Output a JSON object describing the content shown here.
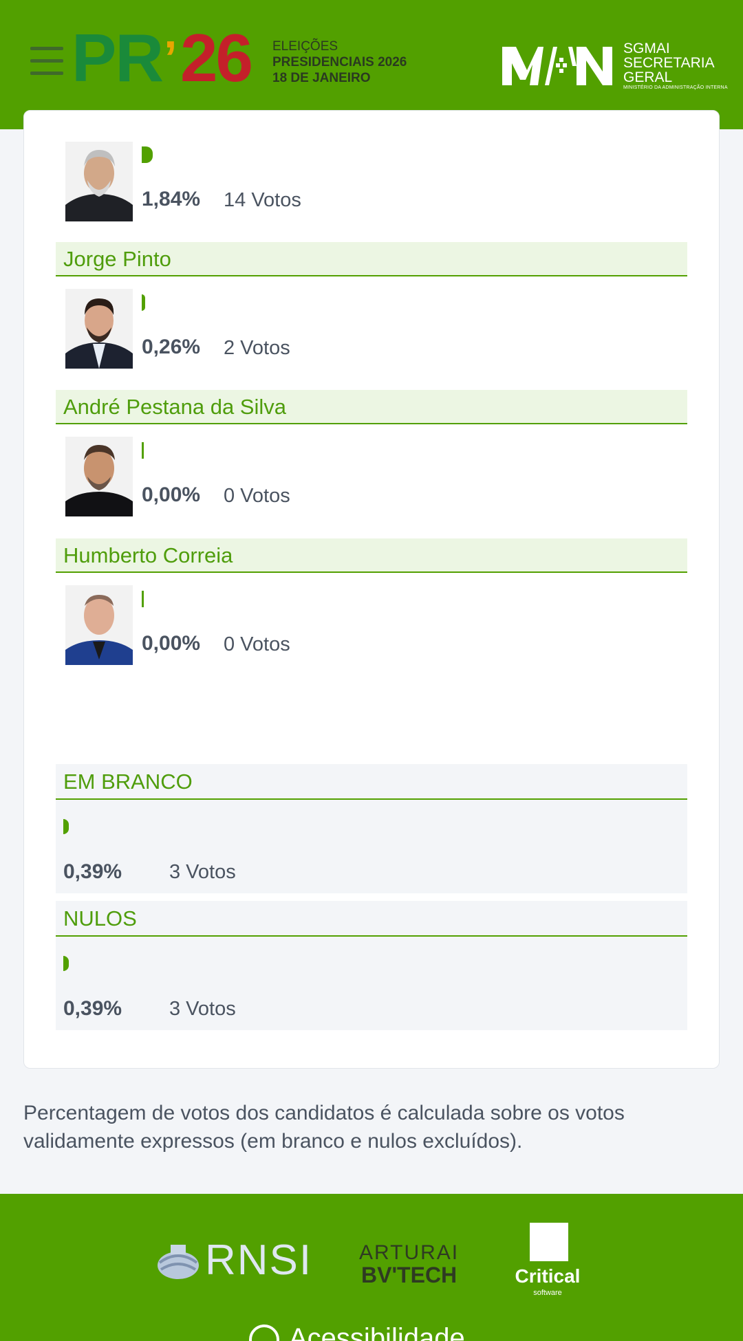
{
  "header": {
    "logo_pr": "PR",
    "logo_apostrophe": "’",
    "logo_26": "26",
    "logo_line1": "ELEIÇÕES",
    "logo_line2": "PRESIDENCIAIS 2026",
    "logo_line3": "18 DE JANEIRO",
    "org_line1": "SGMAI",
    "org_line2": "SECRETARIA",
    "org_line3": "GERAL",
    "org_line4": "MINISTÉRIO DA ADMINISTRAÇÃO INTERNA",
    "brand_color": "#52a000"
  },
  "candidates": [
    {
      "name": "",
      "percent": "1,84%",
      "votes": "14 Votos",
      "bar_fraction": 0.0184
    },
    {
      "name": "Jorge Pinto",
      "percent": "0,26%",
      "votes": "2 Votos",
      "bar_fraction": 0.0026
    },
    {
      "name": "André Pestana da Silva",
      "percent": "0,00%",
      "votes": "0 Votos",
      "bar_fraction": 0.0
    },
    {
      "name": "Humberto Correia",
      "percent": "0,00%",
      "votes": "0 Votos",
      "bar_fraction": 0.0
    }
  ],
  "blank": {
    "label": "EM BRANCO",
    "percent": "0,39%",
    "votes": "3 Votos"
  },
  "null_votes": {
    "label": "NULOS",
    "percent": "0,39%",
    "votes": "3 Votos"
  },
  "note": "Percentagem de votos dos candidatos é calculada sobre os votos validamente expressos (em branco e nulos excluídos).",
  "footer": {
    "partner1": "RNSI",
    "partner2_line1": "ARTURAI",
    "partner2_line2": "BV'TECH",
    "partner3": "Critical",
    "partner3_sub": "software",
    "accessibility": "Acessibilidade"
  }
}
